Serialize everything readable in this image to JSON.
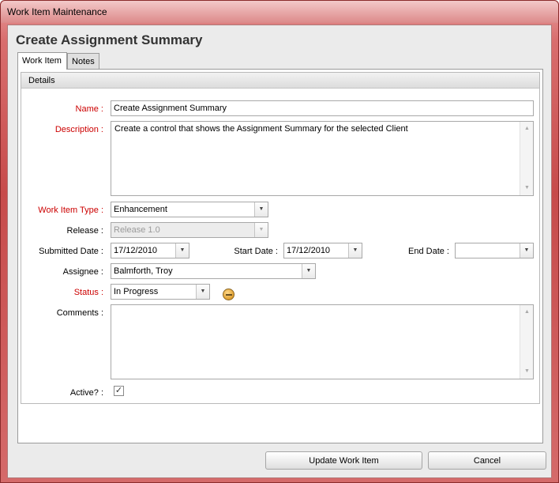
{
  "window": {
    "title": "Work Item Maintenance"
  },
  "form": {
    "title": "Create Assignment Summary"
  },
  "tabs": [
    {
      "label": "Work Item"
    },
    {
      "label": "Notes"
    }
  ],
  "details": {
    "header": "Details",
    "name": {
      "label": "Name :",
      "value": "Create Assignment Summary"
    },
    "description": {
      "label": "Description :",
      "value": "Create a control that shows the Assignment Summary for the selected Client"
    },
    "work_item_type": {
      "label": "Work Item Type :",
      "value": "Enhancement"
    },
    "release": {
      "label": "Release :",
      "value": "Release 1.0"
    },
    "submitted_date": {
      "label": "Submitted Date :",
      "value": "17/12/2010"
    },
    "start_date": {
      "label": "Start Date :",
      "value": "17/12/2010"
    },
    "end_date": {
      "label": "End Date :",
      "value": ""
    },
    "assignee": {
      "label": "Assignee :",
      "value": "Balmforth, Troy"
    },
    "status": {
      "label": "Status :",
      "value": "In Progress",
      "icon": "in-progress-status-icon"
    },
    "comments": {
      "label": "Comments :",
      "value": ""
    },
    "active": {
      "label": "Active? :",
      "checked": true,
      "mark": "✓"
    }
  },
  "buttons": {
    "update": "Update Work Item",
    "cancel": "Cancel"
  },
  "colors": {
    "required_label": "#cc0000",
    "window_frame": "#c74b4b"
  }
}
